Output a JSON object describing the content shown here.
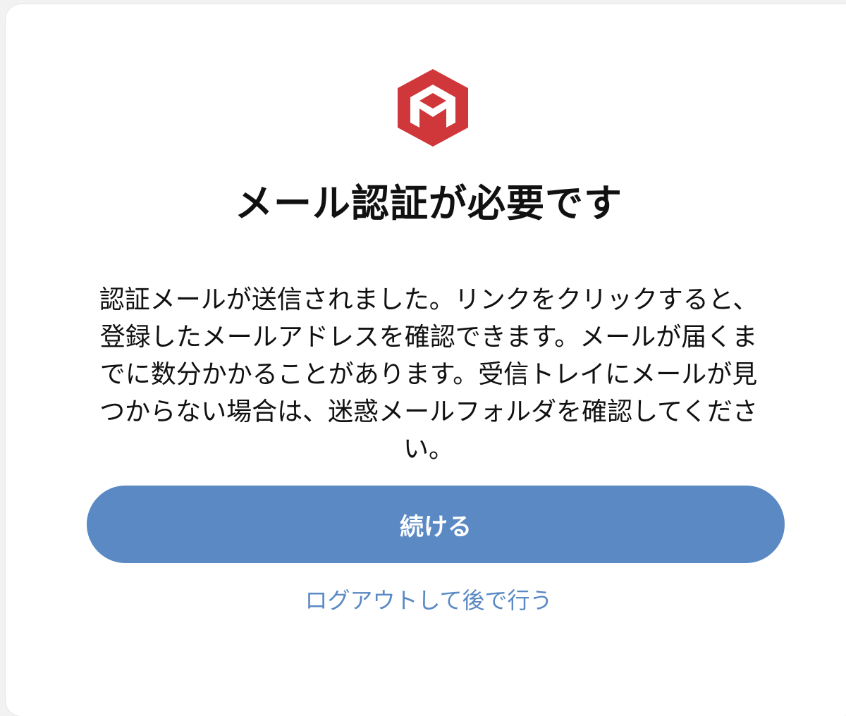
{
  "brand": {
    "logo_icon": "red-hexagon-m-logo",
    "logo_color": "#d0373a"
  },
  "dialog": {
    "title": "メール認証が必要です",
    "description": "認証メールが送信されました。リンクをクリックすると、登録したメールアドレスを確認できます。メールが届くまでに数分かかることがあります。受信トレイにメールが見つからない場合は、迷惑メールフォルダを確認してください。",
    "continue_label": "続ける",
    "logout_label": "ログアウトして後で行う"
  },
  "colors": {
    "accent": "#5a89c4",
    "text": "#111111",
    "background": "#ffffff"
  }
}
